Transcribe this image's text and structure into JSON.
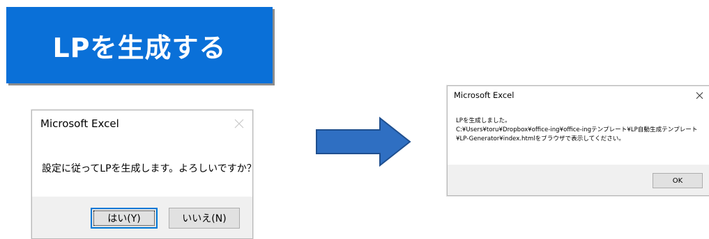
{
  "action_button": {
    "label": "LPを生成する"
  },
  "confirm_dialog": {
    "title": "Microsoft Excel",
    "message": "設定に従ってLPを生成します。よろしいですか？",
    "yes_label": "はい(Y)",
    "no_label": "いいえ(N)"
  },
  "flow_arrow": {
    "icon": "right-arrow"
  },
  "result_dialog": {
    "title": "Microsoft Excel",
    "line1": "LPを生成しました。",
    "line2": "C:¥Users¥toru¥Dropbox¥office-ing¥office-ingテンプレート¥LP自動生成テンプレート",
    "line3": "¥LP-Generator¥index.htmlをブラウザで表示してください。",
    "ok_label": "OK"
  },
  "colors": {
    "accent_blue": "#0a70d8",
    "arrow_fill": "#2f6fc2",
    "arrow_stroke": "#1f4f8f",
    "dialog_footer": "#f0f0f0",
    "button_face": "#e1e1e1",
    "default_button_border": "#0078d7"
  }
}
